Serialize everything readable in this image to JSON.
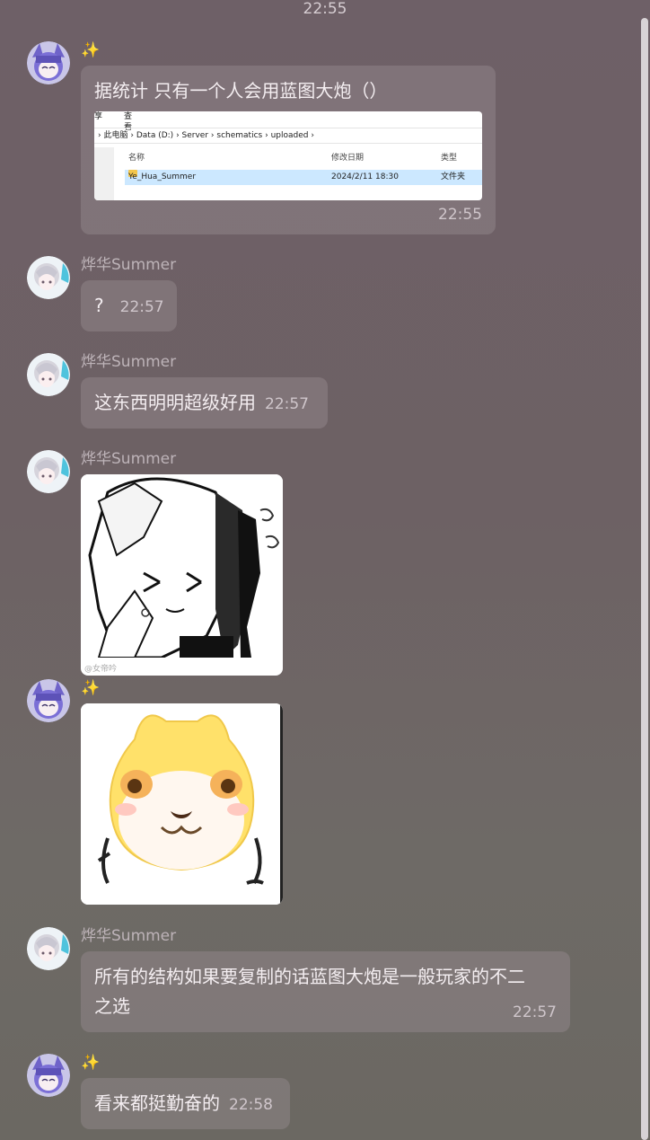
{
  "top_time": "22:55",
  "messages": [
    {
      "sender": "✨",
      "text": "据统计 只有一个人会用蓝图大炮（）",
      "time": "22:55",
      "screenshot": {
        "menu": [
          "享",
          "查看"
        ],
        "path": [
          "此电脑",
          "Data (D:)",
          "Server",
          "schematics",
          "uploaded"
        ],
        "columns": [
          "名称",
          "修改日期",
          "类型"
        ],
        "row": {
          "name": "Ye_Hua_Summer",
          "date": "2024/2/11 18:30",
          "type": "文件夹"
        }
      }
    },
    {
      "sender": "烨华Summer",
      "text": "?",
      "time": "22:57"
    },
    {
      "sender": "烨华Summer",
      "text": "这东西明明超级好用",
      "time": "22:57"
    },
    {
      "sender": "烨华Summer",
      "sticker": "sticker-anime-girl",
      "watermark": "@女帝吟"
    },
    {
      "sender": "✨",
      "sticker": "sticker-shiba"
    },
    {
      "sender": "烨华Summer",
      "text": "所有的结构如果要复制的话蓝图大炮是一般玩家的不二",
      "text_line2": "之选",
      "time": "22:57"
    },
    {
      "sender": "✨",
      "text": "看来都挺勤奋的",
      "time": "22:58"
    }
  ]
}
